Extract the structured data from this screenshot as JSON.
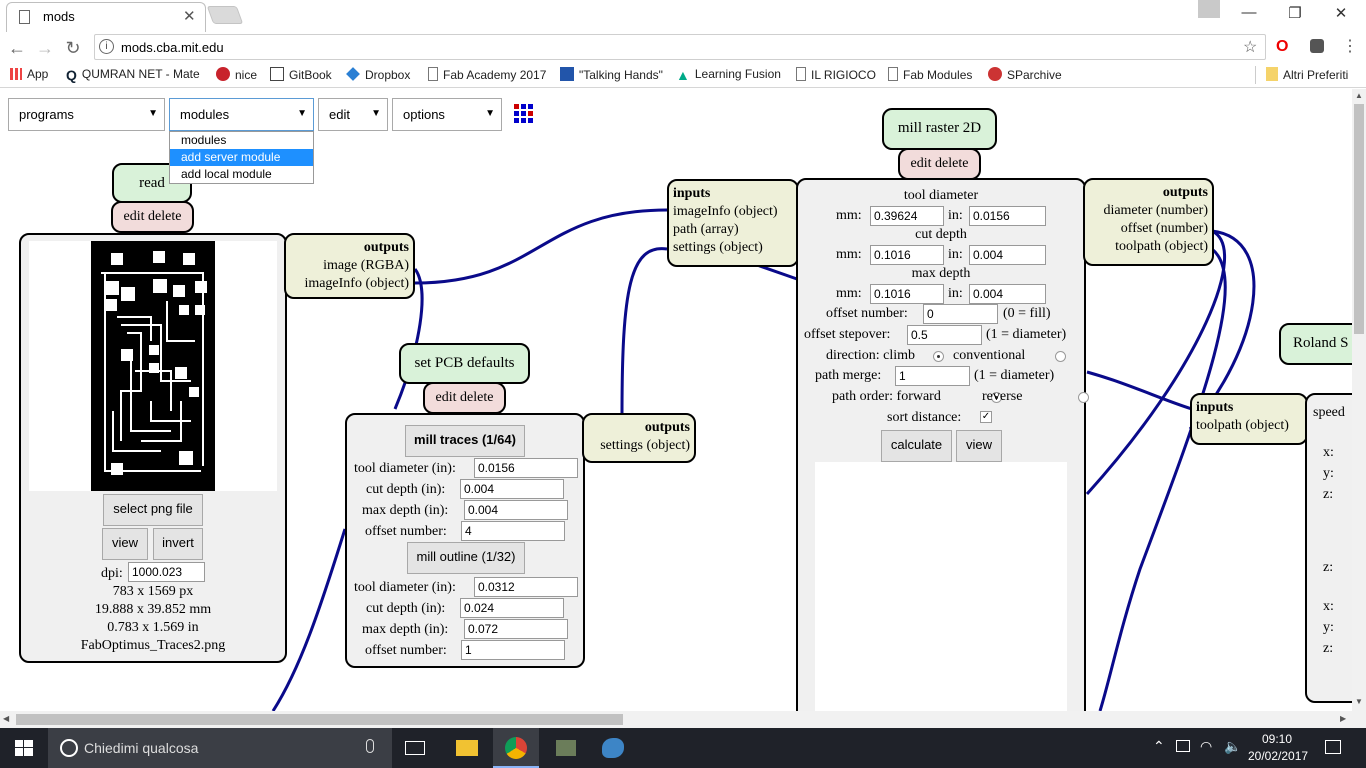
{
  "browser": {
    "tab_title": "mods",
    "url": "mods.cba.mit.edu",
    "bookmarks": [
      "App",
      "QUMRAN NET - Mate",
      "nice",
      "GitBook",
      "Dropbox",
      "Fab Academy 2017",
      "\"Talking Hands\"",
      "Learning Fusion",
      "IL RIGIOCO",
      "Fab Modules",
      "SParchive"
    ],
    "other_bookmarks": "Altri Preferiti"
  },
  "menus": {
    "programs": "programs",
    "modules": "modules",
    "edit": "edit",
    "options": "options",
    "dropdown": [
      "modules",
      "add server module",
      "add local module"
    ]
  },
  "read_png": {
    "title": "read png",
    "edit_delete": "edit delete",
    "select_button": "select png file",
    "view": "view",
    "invert": "invert",
    "dpi_label": "dpi:",
    "dpi_value": "1000.023",
    "size_px": "783 x 1569 px",
    "size_mm": "19.888 x 39.852 mm",
    "size_in": "0.783 x 1.569 in",
    "filename": "FabOptimus_Traces2.png",
    "outputs": "outputs",
    "out1": "image (RGBA)",
    "out2": "imageInfo (object)"
  },
  "pcb": {
    "title": "set PCB defaults",
    "edit_delete": "edit delete",
    "traces_button": "mill traces (1/64)",
    "outline_button": "mill outline (1/32)",
    "labels": {
      "tool_diameter": "tool diameter (in):",
      "cut_depth": "cut depth (in):",
      "max_depth": "max depth (in):",
      "offset_number": "offset number:"
    },
    "traces": {
      "tool_diameter": "0.0156",
      "cut_depth": "0.004",
      "max_depth": "0.004",
      "offset_number": "4"
    },
    "outline": {
      "tool_diameter": "0.0312",
      "cut_depth": "0.024",
      "max_depth": "0.072",
      "offset_number": "1"
    },
    "outputs": "outputs",
    "out1": "settings (object)"
  },
  "raster": {
    "title": "mill raster 2D",
    "edit_delete": "edit delete",
    "inputs": "inputs",
    "in1": "imageInfo (object)",
    "in2": "path (array)",
    "in3": "settings (object)",
    "outputs": "outputs",
    "out1": "diameter (number)",
    "out2": "offset (number)",
    "out3": "toolpath (object)",
    "tool_diameter": "tool diameter",
    "cut_depth": "cut depth",
    "max_depth": "max depth",
    "mm": "mm:",
    "in": "in:",
    "td_mm": "0.39624",
    "td_in": "0.0156",
    "cd_mm": "0.1016",
    "cd_in": "0.004",
    "md_mm": "0.1016",
    "md_in": "0.004",
    "offset_number_label": "offset number:",
    "offset_number": "0",
    "offset_number_hint": "(0 = fill)",
    "offset_stepover_label": "offset stepover:",
    "offset_stepover": "0.5",
    "diameter_hint": "(1 = diameter)",
    "direction_label": "direction: climb",
    "conventional": "conventional",
    "path_merge_label": "path merge:",
    "path_merge": "1",
    "path_order_label": "path order: forward",
    "reverse": "reverse",
    "sort_distance": "sort distance:",
    "calculate": "calculate",
    "view": "view"
  },
  "roland": {
    "title": "Roland S",
    "inputs": "inputs",
    "in1": "toolpath (object)",
    "speed": "speed",
    "x": "x:",
    "y": "y:",
    "z": "z:"
  },
  "taskbar": {
    "search": "Chiedimi qualcosa",
    "time": "09:10",
    "date": "20/02/2017"
  }
}
